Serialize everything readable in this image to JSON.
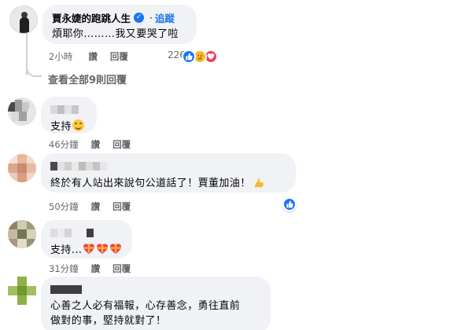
{
  "comments": [
    {
      "author": "賈永婕的跑跳人生",
      "separator": "·",
      "follow_label": "追蹤",
      "text": "煩耶你………我又要哭了啦",
      "time": "2小時",
      "like_label": "讚",
      "reply_label": "回覆",
      "reaction_count": "226",
      "reaction_icons": [
        "like-icon",
        "care-icon",
        "love-icon"
      ]
    },
    {
      "text": "支持",
      "time": "46分鐘",
      "like_label": "讚",
      "reply_label": "回覆",
      "emoji": "smiling-face-icon"
    },
    {
      "text": "終於有人站出來說句公道話了！賈董加油！",
      "time": "50分鐘",
      "like_label": "讚",
      "reply_label": "回覆",
      "emoji": "flexed-biceps-icon",
      "reaction_icons": [
        "like-icon"
      ]
    },
    {
      "text": "支持...",
      "time": "31分鐘",
      "like_label": "讚",
      "reply_label": "回覆",
      "emoji": "heart-with-ribbon-icon"
    },
    {
      "text_line1": "心善之人必有福報，心存善念，勇往直前",
      "text_line2": "做對的事，堅持就對了！"
    }
  ],
  "view_replies_label": "查看全部9則回覆",
  "colors": {
    "bubble": "#f0f2f5",
    "meta_text": "#65676b",
    "link_blue": "#1877f2",
    "thread_line": "#ced0d4"
  }
}
